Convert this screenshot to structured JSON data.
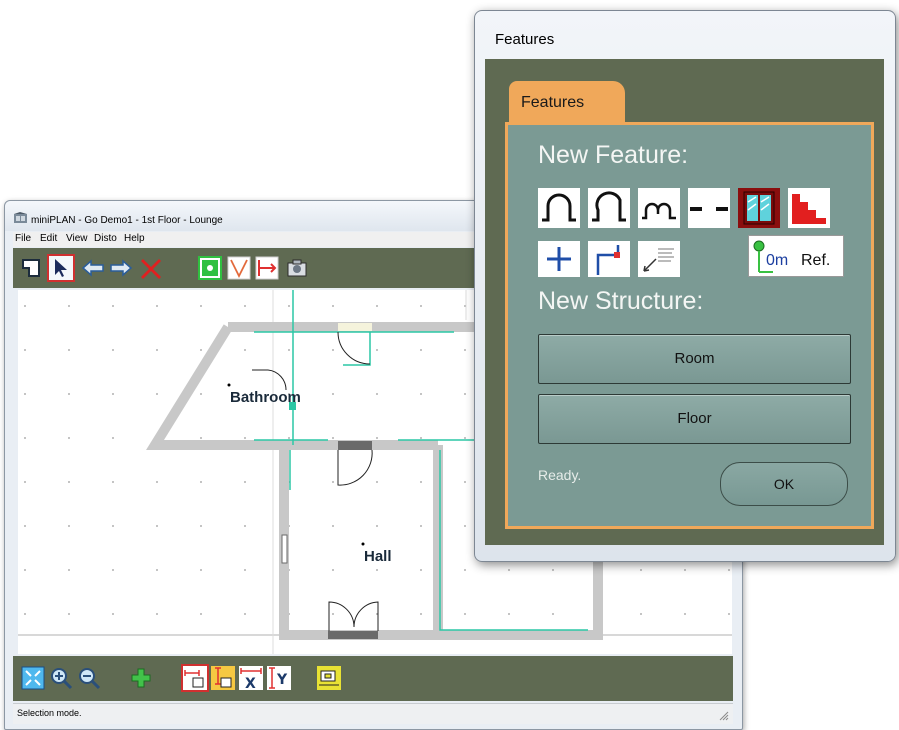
{
  "main_window": {
    "title": "miniPLAN - Go Demo1 - 1st Floor - Lounge",
    "menu": [
      "File",
      "Edit",
      "View",
      "Disto",
      "Help"
    ],
    "toolbar_top_icons": [
      "new-room-icon",
      "select-arrow-icon",
      "back-arrow-icon",
      "forward-arrow-icon",
      "delete-x-icon",
      "snap-point-icon",
      "angle-icon",
      "measure-icon",
      "camera-icon"
    ],
    "toolbar_bottom_icons": [
      "zoom-fit-icon",
      "zoom-in-icon",
      "zoom-out-icon",
      "add-cross-icon",
      "horizontal-dim-icon",
      "vertical-dim-icon",
      "x-dim-icon",
      "y-dim-icon",
      "label-icon"
    ],
    "rooms": {
      "bathroom": "Bathroom",
      "hall": "Hall"
    },
    "status": "Selection mode."
  },
  "features_dialog": {
    "title": "Features",
    "tab": "Features",
    "new_feature_heading": "New Feature:",
    "feature_icons": [
      "door-arch-icon",
      "door-arch-right-icon",
      "double-arch-icon",
      "dashed-opening-icon",
      "window-icon",
      "stairs-icon",
      "cross-point-icon",
      "corner-icon",
      "dimension-note-icon",
      "reference-point-icon"
    ],
    "ref_label": "0m",
    "ref_suffix": "Ref.",
    "new_structure_heading": "New Structure:",
    "room_button": "Room",
    "floor_button": "Floor",
    "status": "Ready.",
    "ok_button": "OK"
  },
  "colors": {
    "toolbar": "#5f6a52",
    "panel": "#7b9a94",
    "accent": "#f0a85a",
    "wall": "#c8c8c8",
    "trace": "#2cc7a5"
  }
}
